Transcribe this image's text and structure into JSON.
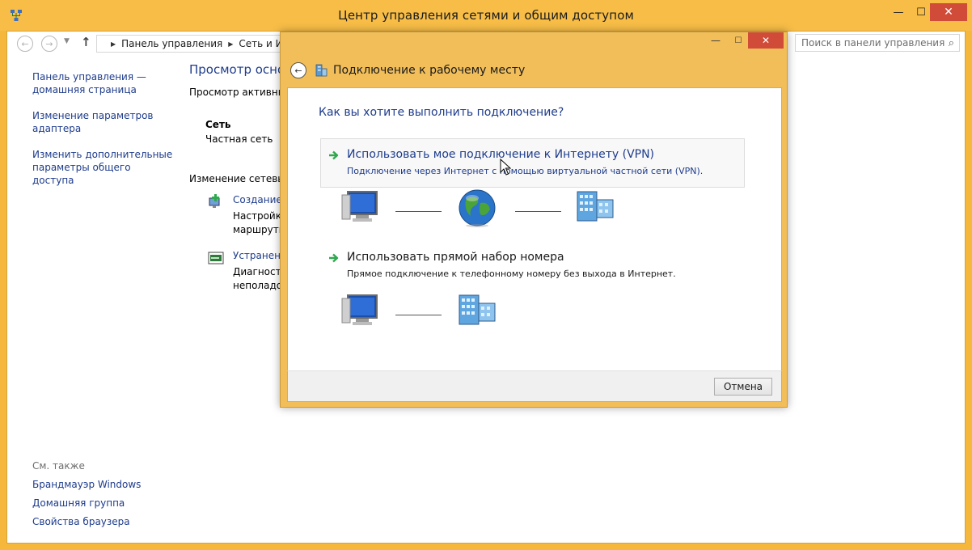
{
  "window": {
    "title": "Центр управления сетями и общим доступом",
    "controls": {
      "minimize": "—",
      "maximize": "☐",
      "close": "✕"
    }
  },
  "address_bar": {
    "breadcrumb": [
      "Панель управления",
      "Сеть и Инте"
    ],
    "search_placeholder": "Поиск в панели управления"
  },
  "left_panel": {
    "links": [
      "Панель управления — домашняя страница",
      "Изменение параметров адаптера",
      "Изменить дополнительные параметры общего доступа"
    ],
    "see_also_title": "См. также",
    "see_also": [
      "Брандмауэр Windows",
      "Домашняя группа",
      "Свойства браузера"
    ]
  },
  "content": {
    "heading": "Просмотр основных сведений о сети",
    "active_networks_label": "Просмотр активных сетей",
    "network_name": "Сеть",
    "network_type": "Частная сеть",
    "change_settings_label": "Изменение сетевых параметров",
    "tasks": [
      {
        "link": "Создание и настройка нового подключения или сети",
        "desc_line1": "Настройка",
        "desc_line2": "маршрути"
      },
      {
        "link": "Устранение неполадок",
        "desc_line1": "Диагности",
        "desc_line2": "неполадок"
      }
    ]
  },
  "dialog": {
    "title": "Подключение к рабочему месту",
    "controls": {
      "minimize": "—",
      "maximize": "☐",
      "close": "✕"
    },
    "question": "Как вы хотите выполнить подключение?",
    "options": [
      {
        "title": "Использовать мое подключение к Интернету (VPN)",
        "description": "Подключение через Интернет с помощью виртуальной частной сети (VPN)."
      },
      {
        "title": "Использовать прямой набор номера",
        "description": "Прямое подключение к телефонному номеру без выхода в Интернет."
      }
    ],
    "cancel_label": "Отмена"
  },
  "colors": {
    "window_frame": "#f6b83c",
    "link_blue": "#1e3c8c",
    "close_red": "#d14b39",
    "arrow_green": "#2fa84f"
  }
}
